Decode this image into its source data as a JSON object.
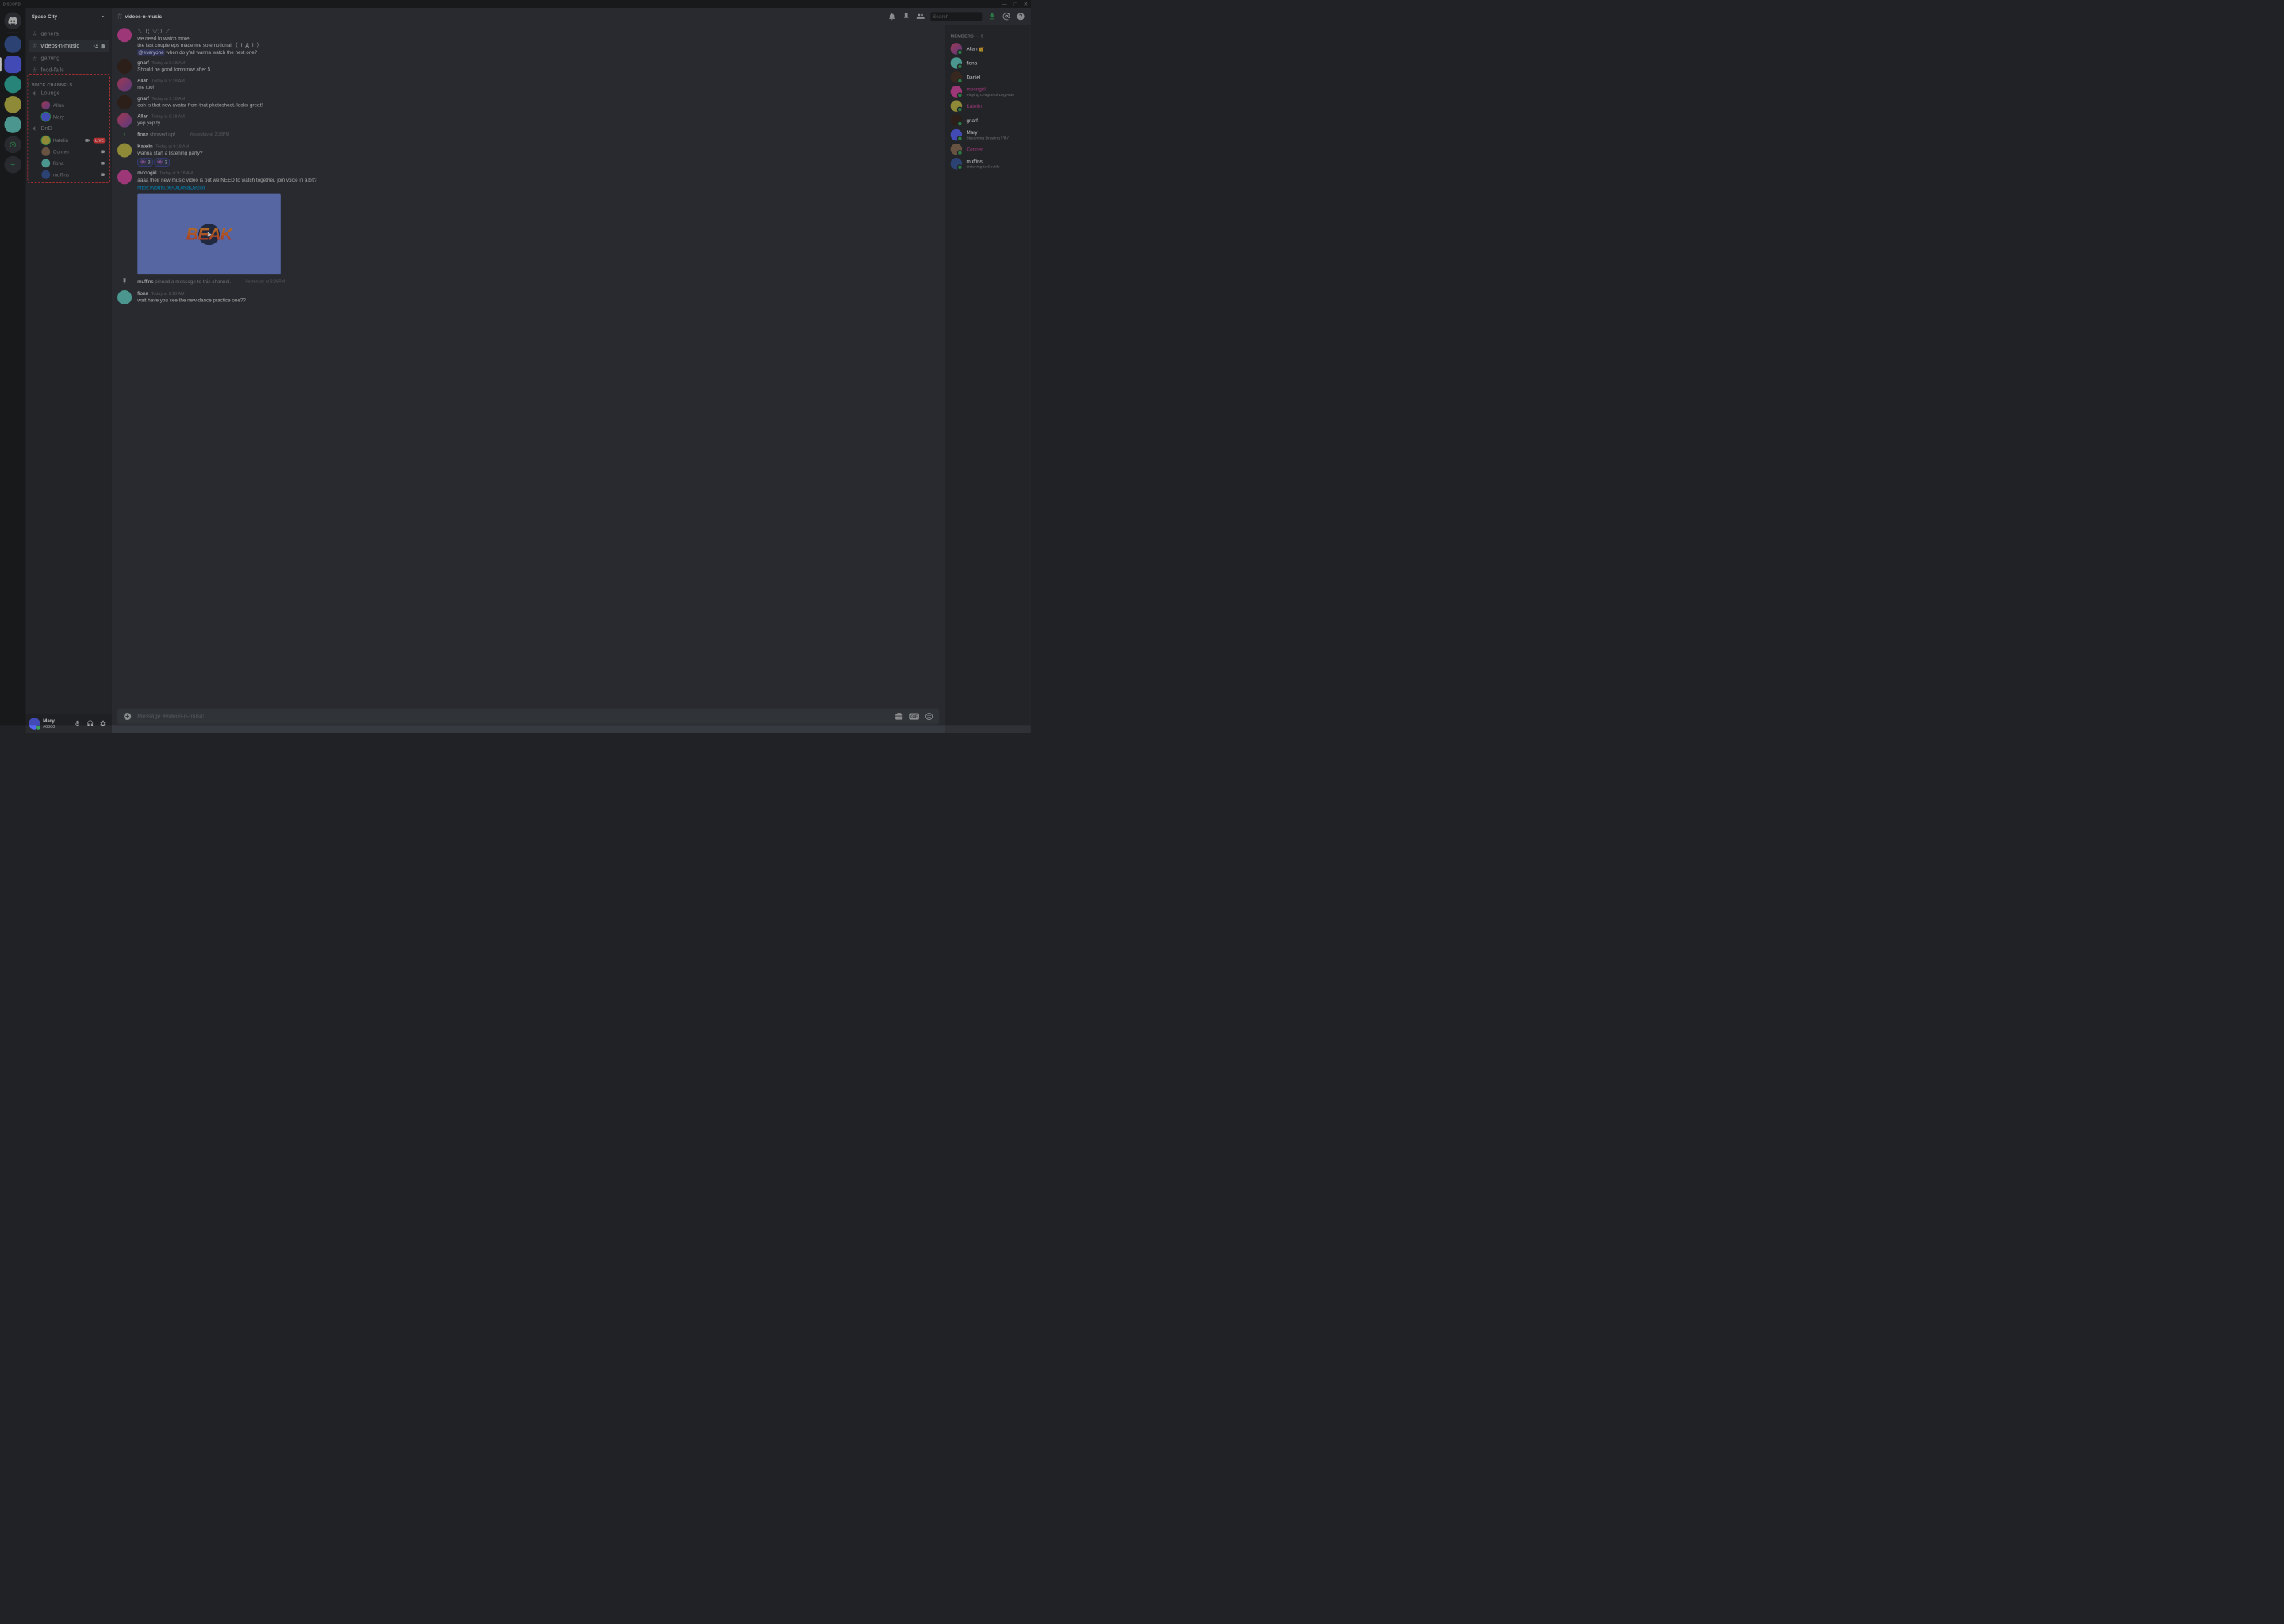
{
  "titlebar": {
    "brand": "DISCORD"
  },
  "server": {
    "name": "Space City"
  },
  "textChannels": [
    {
      "name": "general",
      "active": false
    },
    {
      "name": "videos-n-music",
      "active": true
    },
    {
      "name": "gaming",
      "active": false
    },
    {
      "name": "food-fails",
      "active": false
    }
  ],
  "voiceCategory": "VOICE CHANNELS",
  "voiceChannels": [
    {
      "name": "Lounge",
      "users": [
        {
          "name": "Allan",
          "avatar": "allan"
        },
        {
          "name": "Mary",
          "avatar": "mary",
          "speaking": true
        }
      ]
    },
    {
      "name": "DnD",
      "users": [
        {
          "name": "Katelin",
          "avatar": "katelin",
          "speaking": true,
          "live": true,
          "cam": true
        },
        {
          "name": "Conner",
          "avatar": "conner",
          "cam": true
        },
        {
          "name": "fiona",
          "avatar": "fiona",
          "cam": true
        },
        {
          "name": "muffins",
          "avatar": "muffins",
          "cam": true
        }
      ]
    }
  ],
  "liveBadge": "LIVE",
  "userPanel": {
    "name": "Mary",
    "tag": "#0000"
  },
  "chat": {
    "title": "videos-n-music",
    "searchPlaceholder": "Search",
    "inputPlaceholder": "Message #videos-n-music"
  },
  "messages": [
    {
      "type": "cont",
      "avatar": "moongirl",
      "lines": [
        "＼（；▽；）／",
        "we need to watch more",
        "the last couple eps made me so emotional （ ｉ Д ｉ ）"
      ],
      "mentionLine": {
        "mention": "@everyone",
        "rest": " when do y'all wanna watch the next one?"
      }
    },
    {
      "type": "msg",
      "author": "gnarf",
      "avatar": "gnarf",
      "ts": "Today at 9:18 AM",
      "text": "Should be good tomorrow after 5"
    },
    {
      "type": "msg",
      "author": "Allan",
      "avatar": "allan",
      "ts": "Today at 9:18 AM",
      "text": "me too!"
    },
    {
      "type": "msg",
      "author": "gnarf",
      "avatar": "gnarf",
      "ts": "Today at 9:18 AM",
      "text": "ooh is that new avatar from that photoshoot. looks great!"
    },
    {
      "type": "msg",
      "author": "Allan",
      "avatar": "allan",
      "ts": "Today at 9:18 AM",
      "text": "yep yep ty"
    },
    {
      "type": "join",
      "user": "fiona",
      "action": " showed up!",
      "ts": "Yesterday at 2:38PM"
    },
    {
      "type": "msg",
      "author": "Katelin",
      "avatar": "katelin",
      "ts": "Today at 9:18 AM",
      "text": "wanna start a listening party?",
      "reactions": [
        {
          "emoji": "👾",
          "count": "3"
        },
        {
          "emoji": "👾",
          "count": "3"
        }
      ]
    },
    {
      "type": "msg",
      "author": "moongirl",
      "avatar": "moongirl",
      "ts": "Today at 9:18 AM",
      "text": "aaaa their new music video is out we NEED to watch together. join voice in a bit?",
      "link": "https://youtu.be/OiDx6aQ928o",
      "embed": true
    },
    {
      "type": "pin",
      "user": "muffins",
      "action": " pinned a message to this channel.",
      "ts": "Yesterday at 2:38PM"
    },
    {
      "type": "msg",
      "author": "fiona",
      "avatar": "fiona",
      "ts": "Today at 9:18 AM",
      "text": "wait have you see the new dance practice one??"
    }
  ],
  "membersHeader": "MEMBERS — 9",
  "members": [
    {
      "name": "Allan",
      "avatar": "allan",
      "crown": true,
      "color": "#ffffff"
    },
    {
      "name": "fiona",
      "avatar": "fiona",
      "color": "#ffffff"
    },
    {
      "name": "Daniel",
      "avatar": "daniel",
      "color": "#ffffff"
    },
    {
      "name": "moongirl",
      "avatar": "moongirl",
      "activity": "Playing League of Legends",
      "color": "#d24aa0"
    },
    {
      "name": "Katelin",
      "avatar": "katelin",
      "color": "#d24aa0"
    },
    {
      "name": "gnarf",
      "avatar": "gnarf",
      "color": "#ffffff"
    },
    {
      "name": "Mary",
      "avatar": "mary",
      "activity": "Streaming Drawing \\·∀·/",
      "color": "#ffffff"
    },
    {
      "name": "Conner",
      "avatar": "conner",
      "color": "#d24aa0"
    },
    {
      "name": "muffins",
      "avatar": "muffins",
      "activity": "Listening to Spotify",
      "color": "#ffffff"
    }
  ],
  "embedText": "BEAK"
}
